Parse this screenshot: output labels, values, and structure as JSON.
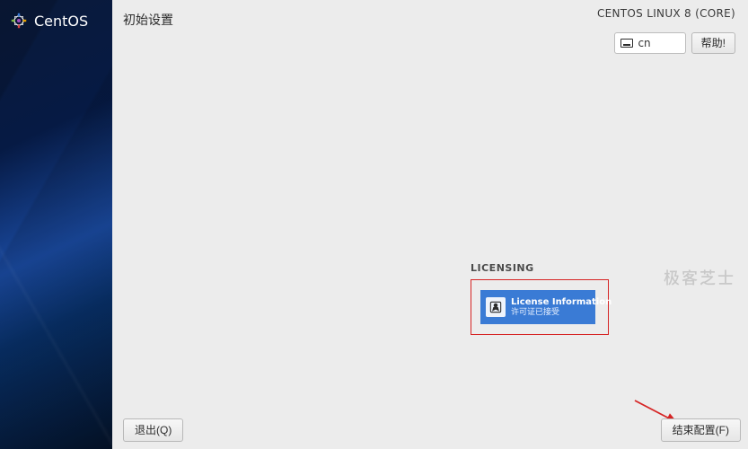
{
  "sidebar": {
    "brand": "CentOS"
  },
  "header": {
    "title": "初始设置",
    "distro": "CENTOS LINUX 8 (CORE)",
    "language_code": "cn",
    "help_label": "帮助!"
  },
  "licensing": {
    "section_label": "LICENSING",
    "spoke_title": "License Information",
    "spoke_status": "许可证已接受"
  },
  "footer": {
    "quit_label": "退出(Q)",
    "finish_label": "结束配置(F)"
  },
  "watermark": "极客芝士"
}
